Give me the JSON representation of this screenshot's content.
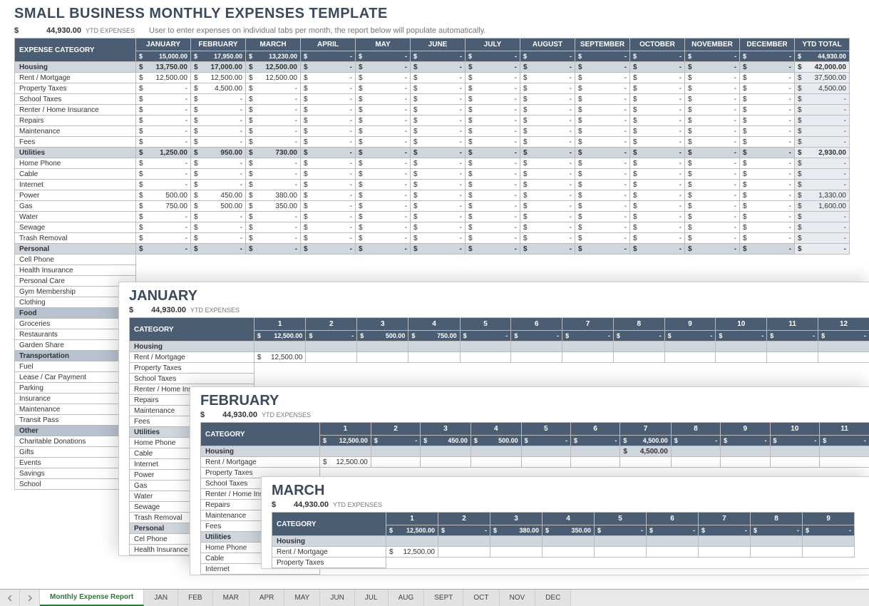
{
  "title": "SMALL BUSINESS MONTHLY EXPENSES TEMPLATE",
  "ytd": {
    "currency": "$",
    "amount": "44,930.00",
    "label": "YTD EXPENSES"
  },
  "note": "User to enter expenses on individual tabs per month, the report below will populate automatically.",
  "header": {
    "category": "EXPENSE CATEGORY",
    "months": [
      "JANUARY",
      "FEBRUARY",
      "MARCH",
      "APRIL",
      "MAY",
      "JUNE",
      "JULY",
      "AUGUST",
      "SEPTEMBER",
      "OCTOBER",
      "NOVEMBER",
      "DECEMBER"
    ],
    "ytd": "YTD TOTAL",
    "totals": [
      "15,000.00",
      "17,950.00",
      "13,230.00",
      "-",
      "-",
      "-",
      "-",
      "-",
      "-",
      "-",
      "-",
      "-",
      "44,930.00"
    ]
  },
  "rows": [
    {
      "g": true,
      "name": "Housing",
      "vals": [
        "13,750.00",
        "17,000.00",
        "12,500.00",
        "-",
        "-",
        "-",
        "-",
        "-",
        "-",
        "-",
        "-",
        "-",
        "42,000.00"
      ]
    },
    {
      "name": "Rent / Mortgage",
      "vals": [
        "12,500.00",
        "12,500.00",
        "12,500.00",
        "-",
        "-",
        "-",
        "-",
        "-",
        "-",
        "-",
        "-",
        "-",
        "37,500.00"
      ]
    },
    {
      "name": "Property Taxes",
      "vals": [
        "-",
        "4,500.00",
        "-",
        "-",
        "-",
        "-",
        "-",
        "-",
        "-",
        "-",
        "-",
        "-",
        "4,500.00"
      ]
    },
    {
      "name": "School Taxes",
      "vals": [
        "-",
        "-",
        "-",
        "-",
        "-",
        "-",
        "-",
        "-",
        "-",
        "-",
        "-",
        "-",
        "-"
      ]
    },
    {
      "name": "Renter / Home Insurance",
      "vals": [
        "-",
        "-",
        "-",
        "-",
        "-",
        "-",
        "-",
        "-",
        "-",
        "-",
        "-",
        "-",
        "-"
      ]
    },
    {
      "name": "Repairs",
      "vals": [
        "-",
        "-",
        "-",
        "-",
        "-",
        "-",
        "-",
        "-",
        "-",
        "-",
        "-",
        "-",
        "-"
      ]
    },
    {
      "name": "Maintenance",
      "vals": [
        "-",
        "-",
        "-",
        "-",
        "-",
        "-",
        "-",
        "-",
        "-",
        "-",
        "-",
        "-",
        "-"
      ]
    },
    {
      "name": "Fees",
      "vals": [
        "-",
        "-",
        "-",
        "-",
        "-",
        "-",
        "-",
        "-",
        "-",
        "-",
        "-",
        "-",
        "-"
      ]
    },
    {
      "g": true,
      "name": "Utilities",
      "vals": [
        "1,250.00",
        "950.00",
        "730.00",
        "-",
        "-",
        "-",
        "-",
        "-",
        "-",
        "-",
        "-",
        "-",
        "2,930.00"
      ]
    },
    {
      "name": "Home Phone",
      "vals": [
        "-",
        "-",
        "-",
        "-",
        "-",
        "-",
        "-",
        "-",
        "-",
        "-",
        "-",
        "-",
        "-"
      ]
    },
    {
      "name": "Cable",
      "vals": [
        "-",
        "-",
        "-",
        "-",
        "-",
        "-",
        "-",
        "-",
        "-",
        "-",
        "-",
        "-",
        "-"
      ]
    },
    {
      "name": "Internet",
      "vals": [
        "-",
        "-",
        "-",
        "-",
        "-",
        "-",
        "-",
        "-",
        "-",
        "-",
        "-",
        "-",
        "-"
      ]
    },
    {
      "name": "Power",
      "vals": [
        "500.00",
        "450.00",
        "380.00",
        "-",
        "-",
        "-",
        "-",
        "-",
        "-",
        "-",
        "-",
        "-",
        "1,330.00"
      ]
    },
    {
      "name": "Gas",
      "vals": [
        "750.00",
        "500.00",
        "350.00",
        "-",
        "-",
        "-",
        "-",
        "-",
        "-",
        "-",
        "-",
        "-",
        "1,600.00"
      ]
    },
    {
      "name": "Water",
      "vals": [
        "-",
        "-",
        "-",
        "-",
        "-",
        "-",
        "-",
        "-",
        "-",
        "-",
        "-",
        "-",
        "-"
      ]
    },
    {
      "name": "Sewage",
      "vals": [
        "-",
        "-",
        "-",
        "-",
        "-",
        "-",
        "-",
        "-",
        "-",
        "-",
        "-",
        "-",
        "-"
      ]
    },
    {
      "name": "Trash Removal",
      "vals": [
        "-",
        "-",
        "-",
        "-",
        "-",
        "-",
        "-",
        "-",
        "-",
        "-",
        "-",
        "-",
        "-"
      ]
    },
    {
      "g": true,
      "name": "Personal",
      "vals": [
        "-",
        "-",
        "-",
        "-",
        "-",
        "-",
        "-",
        "-",
        "-",
        "-",
        "-",
        "-",
        "-"
      ]
    },
    {
      "name": "Cell Phone"
    },
    {
      "name": "Health Insurance"
    },
    {
      "name": "Personal Care"
    },
    {
      "name": "Gym Membership"
    },
    {
      "name": "Clothing"
    },
    {
      "g2": true,
      "name": "Food"
    },
    {
      "name": "Groceries"
    },
    {
      "name": "Restaurants"
    },
    {
      "name": "Garden Share"
    },
    {
      "g2": true,
      "name": "Transportation"
    },
    {
      "name": "Fuel"
    },
    {
      "name": "Lease / Car Payment"
    },
    {
      "name": "Parking"
    },
    {
      "name": "Insurance"
    },
    {
      "name": "Maintenance"
    },
    {
      "name": "Transit Pass"
    },
    {
      "g2": true,
      "name": "Other"
    },
    {
      "name": "Charitable Donations"
    },
    {
      "name": "Gifts"
    },
    {
      "name": "Events"
    },
    {
      "name": "Savings"
    },
    {
      "name": "School"
    }
  ],
  "panels": [
    {
      "title": "JANUARY",
      "ytd": "44,930.00",
      "cols": 12,
      "totals": [
        "12,500.00",
        "-",
        "500.00",
        "750.00",
        "-",
        "-",
        "-",
        "-",
        "-",
        "-",
        "-",
        "-"
      ],
      "rows": [
        {
          "g": true,
          "name": "Housing",
          "vals": [
            "",
            "",
            "",
            "",
            "",
            "",
            "",
            "",
            "",
            "",
            "",
            ""
          ]
        },
        {
          "name": "Rent / Mortgage",
          "vals": [
            "12,500.00",
            "",
            "",
            "",
            "",
            "",
            "",
            "",
            "",
            "",
            "",
            ""
          ]
        },
        {
          "name": "Property Taxes"
        },
        {
          "name": "School Taxes"
        },
        {
          "name": "Renter / Home Insurance"
        },
        {
          "name": "Repairs"
        },
        {
          "name": "Maintenance"
        },
        {
          "name": "Fees"
        },
        {
          "g": true,
          "name": "Utilities"
        },
        {
          "name": "Home Phone"
        },
        {
          "name": "Cable"
        },
        {
          "name": "Internet"
        },
        {
          "name": "Power"
        },
        {
          "name": "Gas"
        },
        {
          "name": "Water"
        },
        {
          "name": "Sewage"
        },
        {
          "name": "Trash Removal"
        },
        {
          "g": true,
          "name": "Personal"
        },
        {
          "name": "Cel Phone"
        },
        {
          "name": "Health Insurance"
        }
      ]
    },
    {
      "title": "FEBRUARY",
      "ytd": "44,930.00",
      "cols": 11,
      "totals": [
        "12,500.00",
        "-",
        "450.00",
        "500.00",
        "-",
        "-",
        "4,500.00",
        "-",
        "-",
        "-",
        "-"
      ],
      "rows": [
        {
          "g": true,
          "name": "Housing",
          "vals": [
            "",
            "",
            "",
            "",
            "",
            "",
            "4,500.00",
            "",
            "",
            "",
            ""
          ]
        },
        {
          "name": "Rent / Mortgage",
          "vals": [
            "12,500.00",
            "",
            "",
            "",
            "",
            "",
            "",
            "",
            "",
            "",
            ""
          ]
        },
        {
          "name": "Property Taxes"
        },
        {
          "name": "School Taxes"
        },
        {
          "name": "Renter / Home Insurance"
        },
        {
          "name": "Repairs"
        },
        {
          "name": "Maintenance"
        },
        {
          "name": "Fees"
        },
        {
          "g": true,
          "name": "Utilities"
        },
        {
          "name": "Home Phone"
        },
        {
          "name": "Cable"
        },
        {
          "name": "Internet"
        }
      ]
    },
    {
      "title": "MARCH",
      "ytd": "44,930.00",
      "cols": 9,
      "totals": [
        "12,500.00",
        "-",
        "380.00",
        "350.00",
        "-",
        "-",
        "-",
        "-",
        "-"
      ],
      "rows": [
        {
          "g": true,
          "name": "Housing",
          "vals": [
            "",
            "",
            "",
            "",
            "",
            "",
            "",
            "",
            ""
          ]
        },
        {
          "name": "Rent / Mortgage",
          "vals": [
            "12,500.00",
            "",
            "",
            "",
            "",
            "",
            "",
            "",
            ""
          ]
        },
        {
          "name": "Property Taxes"
        }
      ]
    }
  ],
  "category_label": "CATEGORY",
  "tabs": [
    "Monthly Expense Report",
    "JAN",
    "FEB",
    "MAR",
    "APR",
    "MAY",
    "JUN",
    "JUL",
    "AUG",
    "SEPT",
    "OCT",
    "NOV",
    "DEC"
  ]
}
